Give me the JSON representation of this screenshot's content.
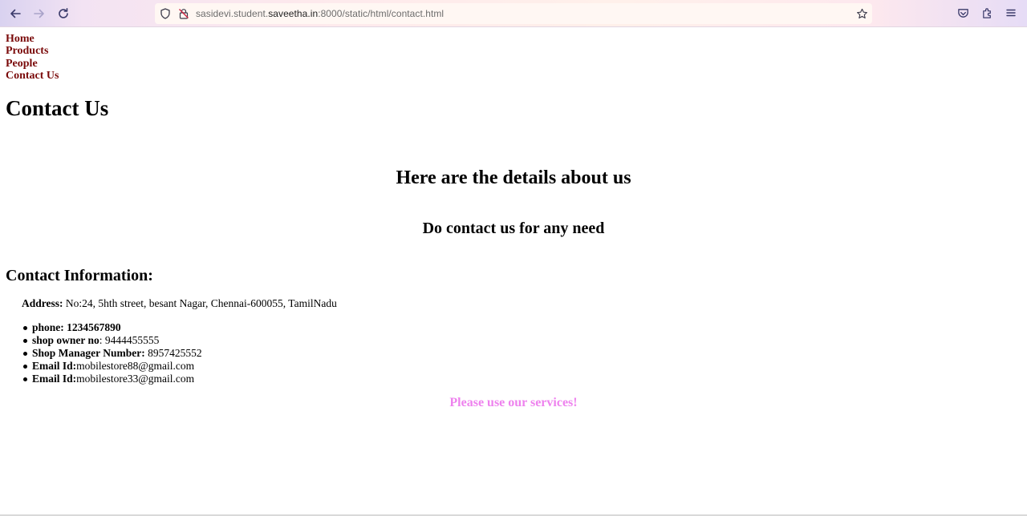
{
  "browser": {
    "url_prefix": "sasidevi.student.",
    "url_domain": "saveetha.in",
    "url_suffix": ":8000/static/html/contact.html",
    "icons": [
      "back-icon",
      "forward-icon",
      "reload-icon",
      "shield-icon",
      "lock-icon",
      "star-icon",
      "pocket-icon",
      "extensions-icon",
      "menu-icon"
    ]
  },
  "nav": {
    "home": "Home",
    "products": "Products",
    "people": "People",
    "contact": "Contact Us"
  },
  "page": {
    "title": "Contact Us",
    "details_heading": "Here are the details about us",
    "contact_need_heading": "Do contact us for any need",
    "info_heading": "Contact Information:",
    "address_label": "Address:",
    "address_value": " No:24, 5hth street, besant Nagar, Chennai-600055, TamilNadu",
    "contacts": [
      {
        "label": "phone: 1234567890",
        "value": ""
      },
      {
        "label": "shop owner no",
        "value": ": 9444455555"
      },
      {
        "label": "Shop Manager Number:",
        "value": " 8957425552"
      },
      {
        "label": "Email Id:",
        "value": "mobilestore88@gmail.com"
      },
      {
        "label": "Email Id:",
        "value": "mobilestore33@gmail.com"
      }
    ],
    "closing": "Please use our services!"
  },
  "colors": {
    "nav_link": "#7a0a0a",
    "closing_text": "#ee82ee"
  }
}
